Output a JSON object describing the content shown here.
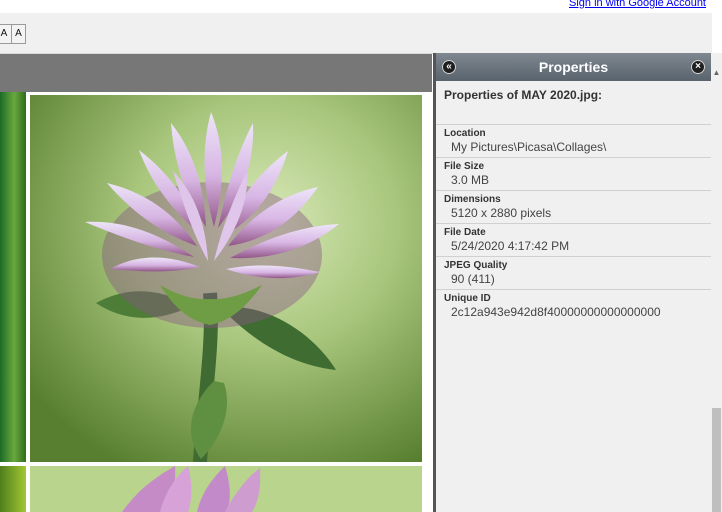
{
  "top": {
    "signin_link": "Sign in with Google Account"
  },
  "toolbar": {
    "font_buttons": [
      "A",
      "A"
    ]
  },
  "panel": {
    "title": "Properties",
    "heading": "Properties of MAY 2020.jpg:",
    "rows": [
      {
        "label": "Location",
        "value": "My Pictures\\Picasa\\Collages\\"
      },
      {
        "label": "File Size",
        "value": "3.0 MB"
      },
      {
        "label": "Dimensions",
        "value": "5120 x 2880 pixels"
      },
      {
        "label": "File Date",
        "value": "5/24/2020 4:17:42 PM"
      },
      {
        "label": "JPEG Quality",
        "value": "90 (411)"
      },
      {
        "label": "Unique ID",
        "value": "2c12a943e942d8f40000000000000000"
      }
    ],
    "left_button_icon": "double-chevron-left-icon",
    "close_button_icon": "close-icon"
  },
  "colors": {
    "panel_header": "#6f7882",
    "panel_bg": "#f0f0f0",
    "viewer_bg": "#5a5a5a",
    "gray_bar": "#777777"
  }
}
